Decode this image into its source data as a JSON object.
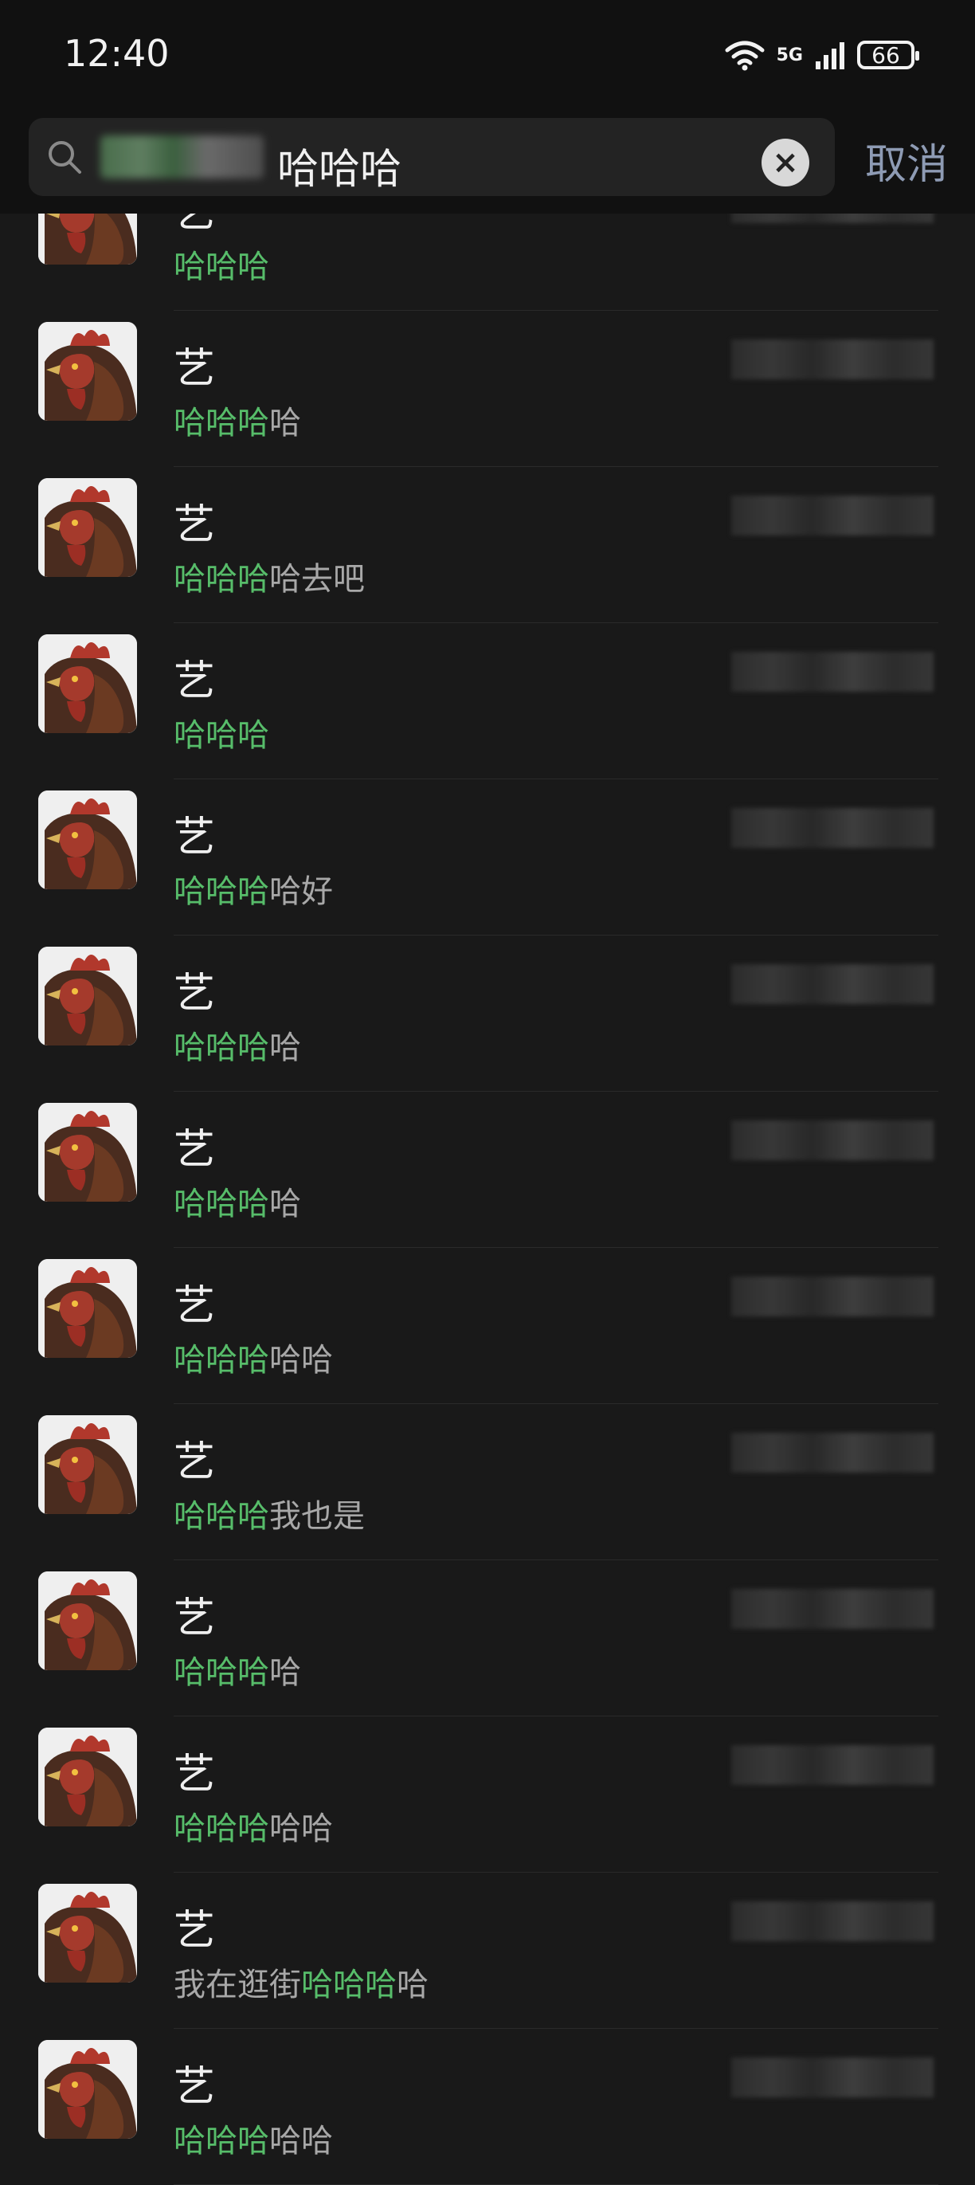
{
  "status": {
    "time": "12:40",
    "network": "5G",
    "battery": "66"
  },
  "search": {
    "query": "哈哈哈",
    "cancel_label": "取消",
    "clear_glyph": "×"
  },
  "icons": {
    "search": "search-icon",
    "clear": "clear-icon",
    "wifi": "wifi-icon",
    "signal": "signal-icon",
    "battery": "battery-icon",
    "avatar": "rooster-avatar"
  },
  "colors": {
    "highlight": "#57bd6a",
    "cancel": "#8e9bb4",
    "background": "#191919"
  },
  "results": [
    {
      "name": "艺",
      "pre": "",
      "match": "哈哈哈",
      "post": ""
    },
    {
      "name": "艺",
      "pre": "",
      "match": "哈哈哈",
      "post": "哈"
    },
    {
      "name": "艺",
      "pre": "",
      "match": "哈哈哈",
      "post": "哈去吧"
    },
    {
      "name": "艺",
      "pre": "",
      "match": "哈哈哈",
      "post": ""
    },
    {
      "name": "艺",
      "pre": "",
      "match": "哈哈哈",
      "post": "哈好"
    },
    {
      "name": "艺",
      "pre": "",
      "match": "哈哈哈",
      "post": "哈"
    },
    {
      "name": "艺",
      "pre": "",
      "match": "哈哈哈",
      "post": "哈"
    },
    {
      "name": "艺",
      "pre": "",
      "match": "哈哈哈",
      "post": "哈哈"
    },
    {
      "name": "艺",
      "pre": "",
      "match": "哈哈哈",
      "post": "我也是"
    },
    {
      "name": "艺",
      "pre": "",
      "match": "哈哈哈",
      "post": "哈"
    },
    {
      "name": "艺",
      "pre": "",
      "match": "哈哈哈",
      "post": "哈哈"
    },
    {
      "name": "艺",
      "pre": "我在逛街",
      "match": "哈哈哈",
      "post": "哈"
    },
    {
      "name": "艺",
      "pre": "",
      "match": "哈哈哈",
      "post": "哈哈"
    }
  ]
}
